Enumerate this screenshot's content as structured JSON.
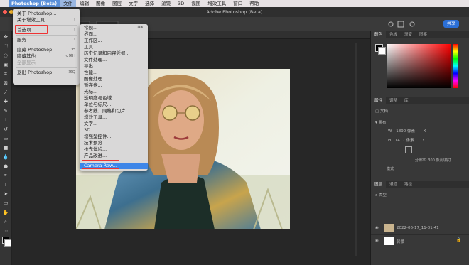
{
  "menubar": {
    "app": "Photoshop (Beta)",
    "items": [
      "文件",
      "编辑",
      "图像",
      "图层",
      "文字",
      "选择",
      "滤镜",
      "3D",
      "视图",
      "增效工具",
      "窗口",
      "帮助"
    ]
  },
  "window": {
    "title": "Adobe Photoshop (Beta)",
    "share_label": "共享"
  },
  "app_menu": {
    "items": [
      {
        "label": "关于 Photoshop...",
        "shortcut": ""
      },
      {
        "label": "关于增效工具",
        "shortcut": ""
      },
      {
        "label": "首选项",
        "shortcut": ""
      },
      {
        "label": "服务",
        "shortcut": ""
      },
      {
        "label": "隐藏 Photoshop",
        "shortcut": "⌃H"
      },
      {
        "label": "隐藏其他",
        "shortcut": "⌥⌘H"
      },
      {
        "label": "全部显示",
        "shortcut": ""
      },
      {
        "label": "退出 Photoshop",
        "shortcut": "⌘Q"
      }
    ]
  },
  "prefs_menu": {
    "items": [
      "常规...",
      "界面...",
      "工作区...",
      "工具...",
      "历史记录和内容凭据...",
      "文件处理...",
      "导出...",
      "性能...",
      "图像处理...",
      "暂存盘...",
      "光标...",
      "透明度与色域...",
      "单位与标尺...",
      "参考线、网格和切片...",
      "增效工具...",
      "文字...",
      "3D...",
      "增强型控件...",
      "技术预览...",
      "抢先体验...",
      "产品改进...",
      "Camera Raw..."
    ],
    "first_shortcut": "⌘K"
  },
  "panels": {
    "color_tabs": [
      "颜色",
      "色板",
      "渐变",
      "图案"
    ],
    "props_tabs": [
      "属性",
      "调整",
      "库"
    ],
    "doc_label": "文档",
    "canvas_label": "画布",
    "width_label": "W",
    "width_value": "1890 像素",
    "height_label": "H",
    "height_value": "1417 像素",
    "x_label": "X",
    "y_label": "Y",
    "resolution": "分辨率: 300 像素/英寸",
    "mode_label": "模式",
    "layers_tabs": [
      "图层",
      "通道",
      "路径"
    ],
    "kind_label": "类型",
    "layers": [
      {
        "name": "2022-06-17_11-01-41"
      },
      {
        "name": "背景"
      }
    ]
  },
  "colors": {
    "accent": "#2b6fd6",
    "highlight": "#e33333",
    "menu_selected": "#3d86e8"
  }
}
